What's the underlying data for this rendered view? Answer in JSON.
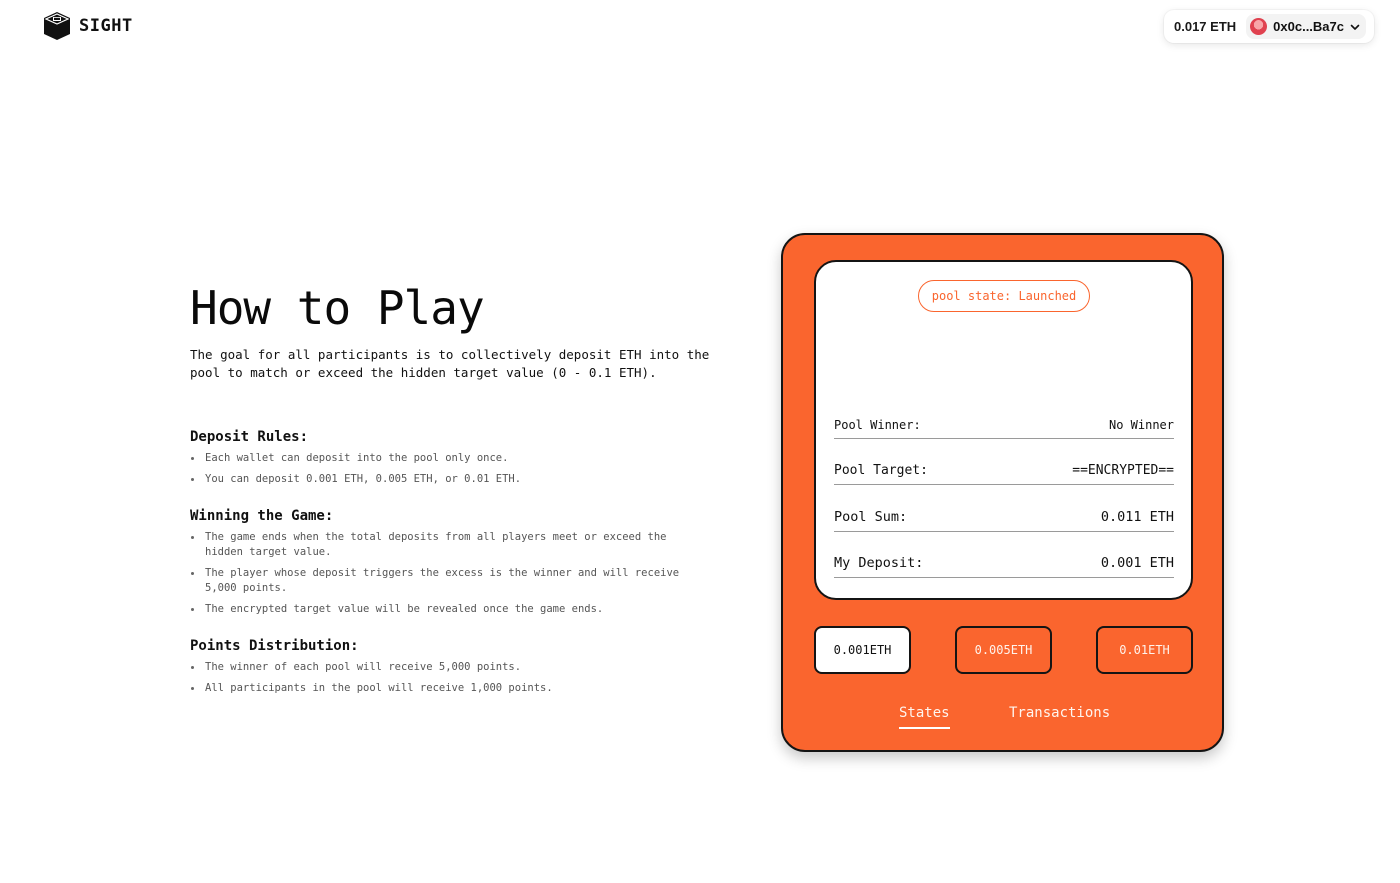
{
  "header": {
    "logo_text": "SIGHT",
    "wallet": {
      "balance": "0.017 ETH",
      "account": "0x0c...Ba7c"
    }
  },
  "intro": {
    "title": "How to Play",
    "description": "The goal for all participants is to collectively deposit ETH into the pool to match or exceed the hidden target value (0 - 0.1 ETH)."
  },
  "rules": {
    "deposit": {
      "heading": "Deposit Rules:",
      "items": [
        "Each wallet can deposit into the pool only once.",
        "You can deposit 0.001 ETH, 0.005 ETH, or 0.01 ETH."
      ]
    },
    "winning": {
      "heading": "Winning the Game:",
      "items": [
        "The game ends when the total deposits from all players meet or exceed the hidden target value.",
        "The player whose deposit triggers the excess is the winner and will receive 5,000 points.",
        "The encrypted target value will be revealed once the game ends."
      ]
    },
    "points": {
      "heading": "Points Distribution:",
      "items": [
        "The winner of each pool will receive 5,000 points.",
        "All participants in the pool will receive 1,000 points."
      ]
    }
  },
  "game": {
    "pool_state": "pool state: Launched",
    "rows": [
      {
        "label": "Pool Winner:",
        "value": "No Winner"
      },
      {
        "label": "Pool Target:",
        "value": "==ENCRYPTED=="
      },
      {
        "label": "Pool Sum:",
        "value": "0.011 ETH"
      },
      {
        "label": "My Deposit:",
        "value": "0.001 ETH"
      }
    ],
    "amounts": [
      "0.001ETH",
      "0.005ETH",
      "0.01ETH"
    ],
    "selected_amount": "0.001ETH",
    "tabs": [
      "States",
      "Transactions"
    ],
    "active_tab": "States"
  },
  "colors": {
    "accent": "#fa652e",
    "outline": "#141414",
    "background": "#ffffff"
  },
  "icons": {
    "logo": "cube-logo-icon",
    "avatar": "account-avatar",
    "dropdown": "chevron-down-icon"
  }
}
